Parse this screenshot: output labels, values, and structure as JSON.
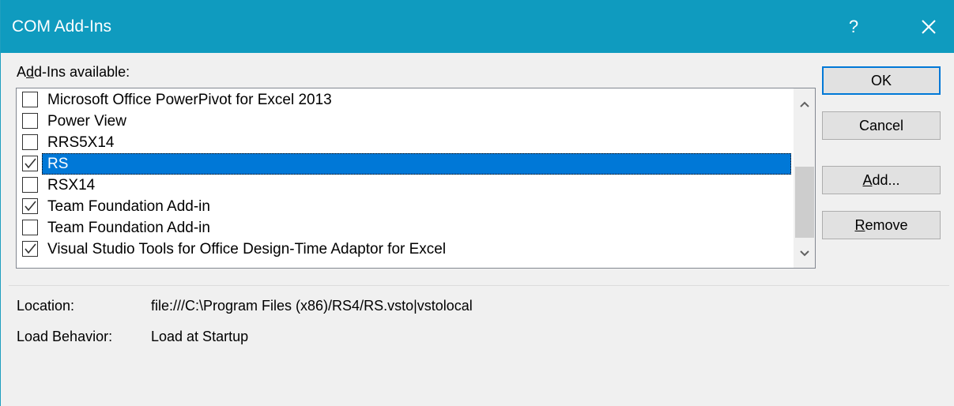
{
  "window": {
    "title": "COM Add-Ins",
    "help_glyph": "?",
    "close_icon": "close-icon",
    "title_bar_color": "#0f9bbf"
  },
  "addins_label": {
    "prefix": "A",
    "accel": "d",
    "rest": "d-Ins available:"
  },
  "addins": [
    {
      "label": "Microsoft Office PowerPivot for Excel 2013",
      "checked": false,
      "selected": false
    },
    {
      "label": "Power View",
      "checked": false,
      "selected": false
    },
    {
      "label": "RRS5X14",
      "checked": false,
      "selected": false
    },
    {
      "label": "RS",
      "checked": true,
      "selected": true
    },
    {
      "label": "RSX14",
      "checked": false,
      "selected": false
    },
    {
      "label": "Team Foundation Add-in",
      "checked": true,
      "selected": false
    },
    {
      "label": "Team Foundation Add-in",
      "checked": false,
      "selected": false
    },
    {
      "label": "Visual Studio Tools for Office Design-Time Adaptor for Excel",
      "checked": true,
      "selected": false
    }
  ],
  "buttons": {
    "ok": "OK",
    "cancel": "Cancel",
    "add": {
      "accel": "A",
      "rest": "dd..."
    },
    "remove": {
      "accel": "R",
      "rest": "emove"
    }
  },
  "info": {
    "location_label": "Location:",
    "location_value": "file:///C:\\Program Files (x86)/RS4/RS.vsto|vstolocal",
    "load_behavior_label": "Load Behavior:",
    "load_behavior_value": "Load at Startup"
  },
  "colors": {
    "selection": "#0078d7",
    "default_button_border": "#0078d7"
  }
}
